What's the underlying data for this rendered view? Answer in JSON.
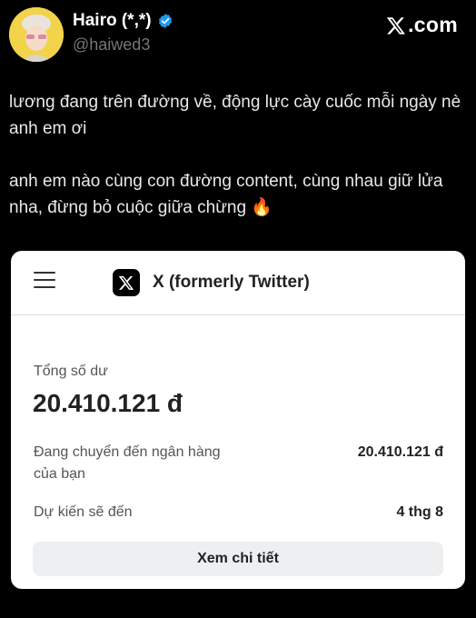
{
  "author": {
    "name": "Hairo (*,*)",
    "handle": "@haiwed3"
  },
  "brand": {
    "text": ".com"
  },
  "tweet": {
    "paragraph_1": "lương đang trên đường về, động lực cày cuốc mỗi ngày nè anh em ơi",
    "paragraph_2": "anh em nào cùng con đường content, cùng nhau giữ lửa nha, đừng bỏ cuộc giữa chừng",
    "emoji": "🔥"
  },
  "card": {
    "app_title": "X (formerly Twitter)",
    "balance_label": "Tổng số dư",
    "balance_amount": "20.410.121 đ",
    "transfer_label": "Đang chuyển đến ngân hàng của bạn",
    "transfer_value": "20.410.121 đ",
    "eta_label": "Dự kiến sẽ đến",
    "eta_value": "4 thg 8",
    "detail_button": "Xem chi tiết"
  },
  "colors": {
    "background": "#000000",
    "verified": "#1d9bf0",
    "avatar_bg": "#f2d34a",
    "card_bg": "#ffffff"
  },
  "icons": [
    "avatar-image",
    "verified-badge-icon",
    "x-logo-icon",
    "hamburger-menu-icon",
    "fire-emoji"
  ]
}
